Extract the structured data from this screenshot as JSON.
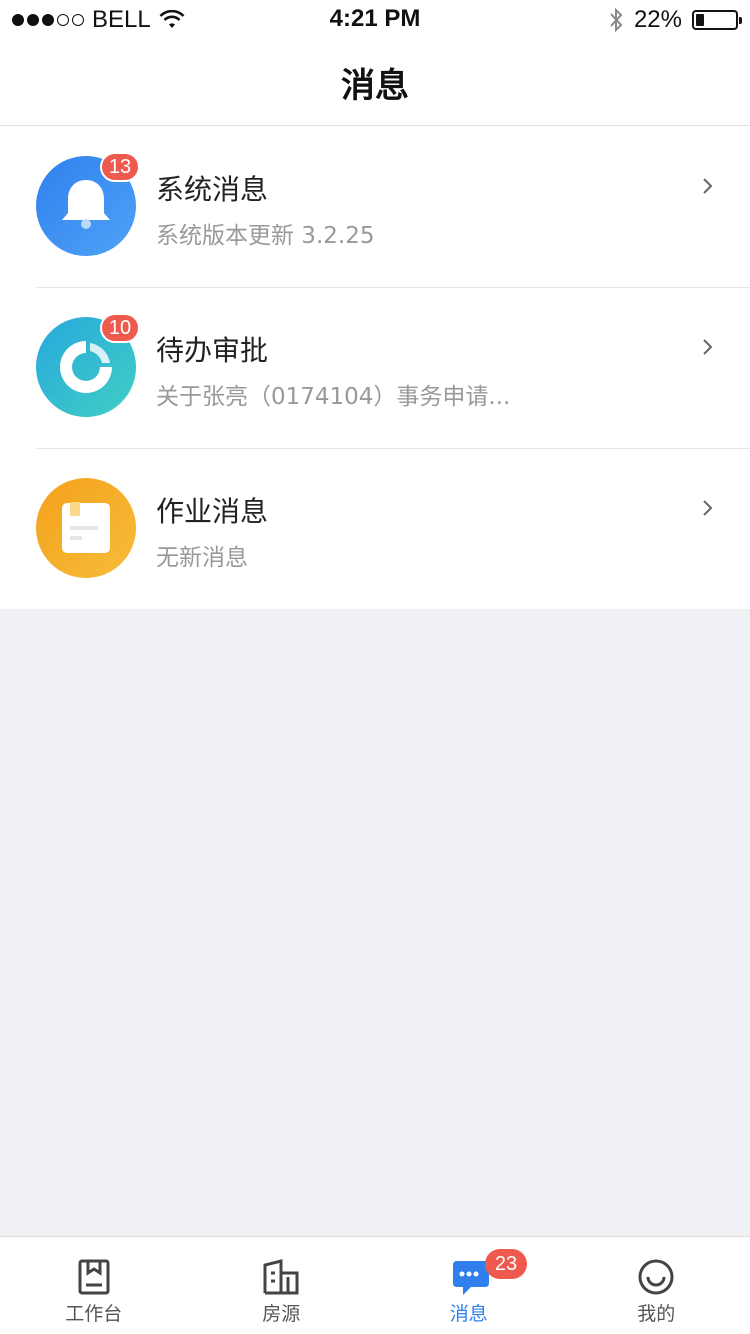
{
  "status_bar": {
    "carrier": "BELL",
    "time": "4:21 PM",
    "battery": "22%",
    "battery_level": 0.22
  },
  "header": {
    "title": "消息"
  },
  "messages": [
    {
      "title": "系统消息",
      "subtitle": "系统版本更新 3.2.25",
      "badge": "13",
      "icon": "bell-icon",
      "color": "#2f80ed"
    },
    {
      "title": "待办审批",
      "subtitle": "关于张亮（0174104）事务申请...",
      "badge": "10",
      "icon": "approval-icon",
      "color": "#2bb8d4"
    },
    {
      "title": "作业消息",
      "subtitle": "无新消息",
      "badge": "",
      "icon": "document-icon",
      "color": "#f5a623"
    }
  ],
  "tabs": [
    {
      "label": "工作台",
      "icon": "bookmark-icon"
    },
    {
      "label": "房源",
      "icon": "building-icon"
    },
    {
      "label": "消息",
      "icon": "chat-icon",
      "badge": "23",
      "active": true
    },
    {
      "label": "我的",
      "icon": "smile-icon"
    }
  ],
  "colors": {
    "accent": "#2f80ed",
    "badge": "#ef5a4f",
    "background": "#f0f1f5"
  }
}
